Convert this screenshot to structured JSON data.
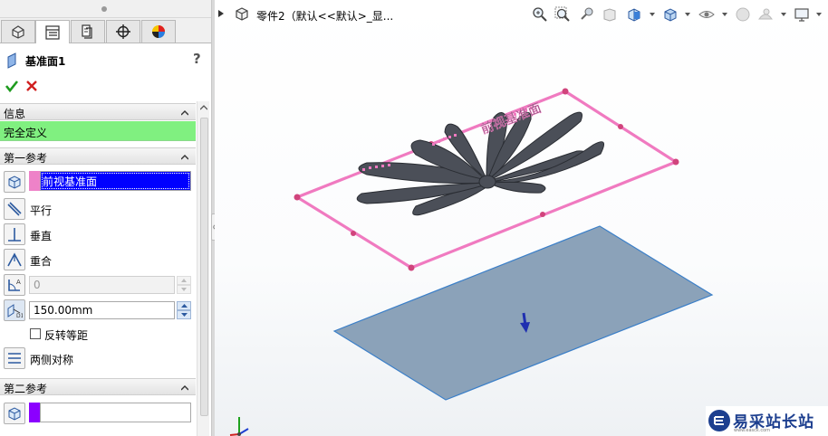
{
  "document": {
    "title": "零件2（默认<<默认>_显..."
  },
  "property_manager": {
    "tabs": [
      "feature-manager",
      "property-manager",
      "configuration-manager",
      "dimxpert-manager",
      "display-manager"
    ],
    "active_tab": "property-manager",
    "feature_title": "基准面1",
    "help_label": "?",
    "sections": {
      "info": {
        "title": "信息",
        "status": "完全定义",
        "status_color": "#80f080"
      },
      "first_reference": {
        "title": "第一参考",
        "reference_value": "前视基准面",
        "swatch_color": "#ee82c8",
        "options": {
          "parallel": "平行",
          "perpendicular": "垂直",
          "coincident": "重合"
        },
        "angle_value": "0",
        "offset_value": "150.00mm",
        "reverse_offset_label": "反转等距",
        "mid_plane_label": "两侧对称"
      },
      "second_reference": {
        "title": "第二参考",
        "reference_value": "",
        "swatch_color": "#8b00ff"
      }
    }
  },
  "graphics": {
    "hud_icons": [
      "zoom-to-fit-icon",
      "zoom-to-area-icon",
      "previous-view-icon",
      "section-view-icon",
      "view-orientation-icon",
      "display-style-icon",
      "hide-show-items-icon",
      "edit-appearance-icon",
      "apply-scene-icon",
      "view-settings-icon"
    ],
    "reference_plane_color": "#f07ac0",
    "new_plane_fill": "#8ba2b9",
    "new_plane_edge": "#3b7fc8",
    "sketch_color": "#4b4f58",
    "engraved_text": "前视基准面"
  },
  "watermark": {
    "text": "易采站长站",
    "url": "www.easck.com"
  }
}
